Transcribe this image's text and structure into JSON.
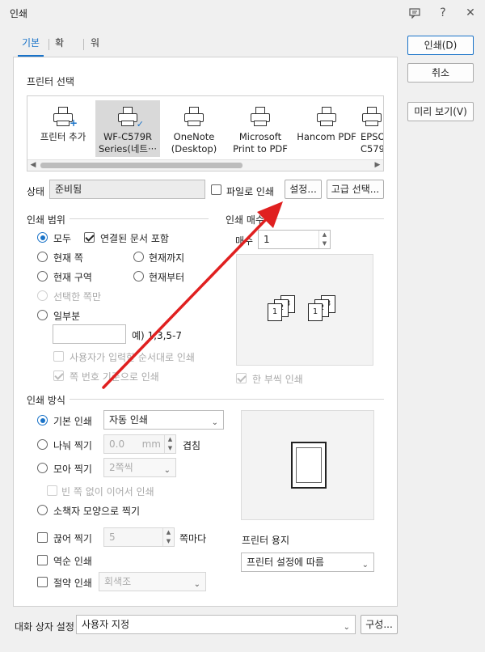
{
  "window": {
    "title": "인쇄"
  },
  "tabs": [
    {
      "label": "기본"
    },
    {
      "label": "확장"
    },
    {
      "label": "워터마크"
    }
  ],
  "buttons": {
    "print": "인쇄(D)",
    "cancel": "취소",
    "preview": "미리 보기(V)",
    "settings": "설정...",
    "advanced": "고급 선택...",
    "configure": "구성..."
  },
  "printer_select": {
    "label": "프린터 선택",
    "printers": [
      {
        "line1": "프린터 추가",
        "line2": ""
      },
      {
        "line1": "WF-C579R",
        "line2": "Series(네트···"
      },
      {
        "line1": "OneNote",
        "line2": "(Desktop)"
      },
      {
        "line1": "Microsoft",
        "line2": "Print to PDF"
      },
      {
        "line1": "Hancom PDF",
        "line2": ""
      },
      {
        "line1": "EPSO",
        "line2": "C579"
      }
    ]
  },
  "status": {
    "label": "상태",
    "value": "준비됨",
    "print_to_file": "파일로 인쇄"
  },
  "print_range": {
    "title": "인쇄 범위",
    "all": "모두",
    "include_linked": "연결된 문서 포함",
    "current_page": "현재 쪽",
    "until_current": "현재까지",
    "current_section": "현재 구역",
    "from_current": "현재부터",
    "selected_only": "선택한 쪽만",
    "partial": "일부분",
    "example": "예) 1,3,5-7",
    "user_order": "사용자가 입력한 순서대로 인쇄",
    "by_page_number": "쪽 번호 기준으로 인쇄"
  },
  "copies": {
    "title": "인쇄 매수",
    "label": "매수",
    "value": "1",
    "collate": "한 부씩 인쇄"
  },
  "print_method": {
    "title": "인쇄 방식",
    "basic": "기본 인쇄",
    "basic_value": "자동 인쇄",
    "split": "나눠 찍기",
    "split_value": "0.0",
    "split_unit": "mm",
    "overlap": "겹침",
    "gather": "모아 찍기",
    "gather_value": "2쪽씩",
    "no_blank": "빈 쪽 없이 이어서 인쇄",
    "booklet": "소책자 모양으로 찍기",
    "cut": "끊어 찍기",
    "cut_value": "5",
    "per_page": "쪽마다",
    "reverse": "역순 인쇄",
    "saving": "절약 인쇄",
    "saving_value": "회색조"
  },
  "paper": {
    "label": "프린터 용지",
    "value": "프린터 설정에 따름"
  },
  "dialog_settings": {
    "label": "대화 상자 설정",
    "value": "사용자 지정"
  },
  "colors": {
    "accent": "#1a73c8",
    "arrow": "#e02020"
  },
  "icons": [
    "feedback-icon",
    "help-icon",
    "close-icon",
    "printer-icon",
    "chevron-down-icon"
  ]
}
